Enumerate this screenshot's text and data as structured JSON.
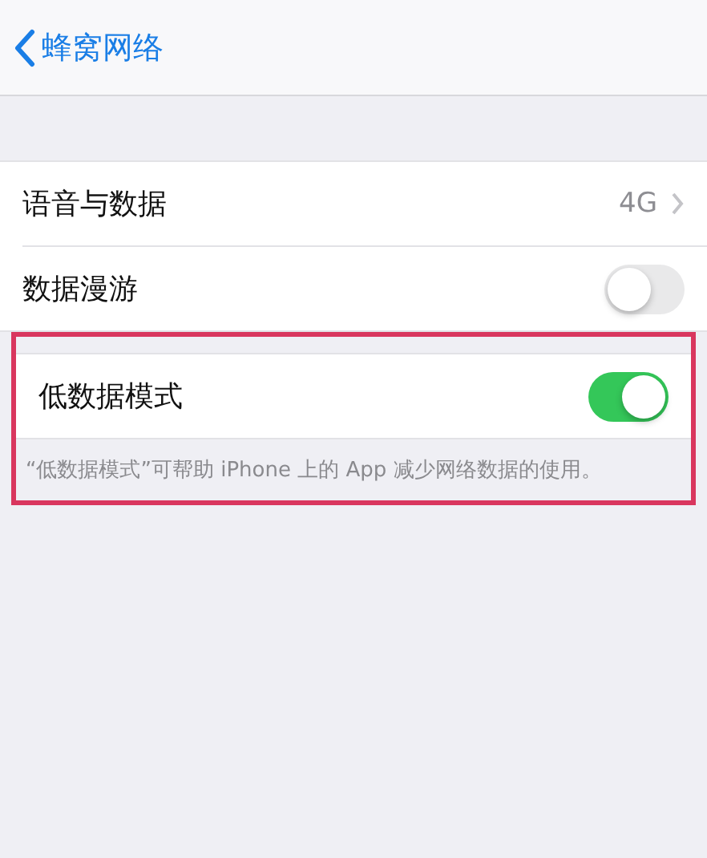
{
  "nav": {
    "back_label": "蜂窝网络"
  },
  "groups": [
    {
      "highlighted": false,
      "rows": [
        {
          "kind": "detail",
          "label": "语音与数据",
          "value": "4G"
        },
        {
          "kind": "toggle",
          "label": "数据漫游",
          "on": false
        }
      ]
    },
    {
      "highlighted": true,
      "rows": [
        {
          "kind": "toggle",
          "label": "低数据模式",
          "on": true
        }
      ],
      "footer": "“低数据模式”可帮助 iPhone 上的 App 减少网络数据的使用。"
    }
  ]
}
